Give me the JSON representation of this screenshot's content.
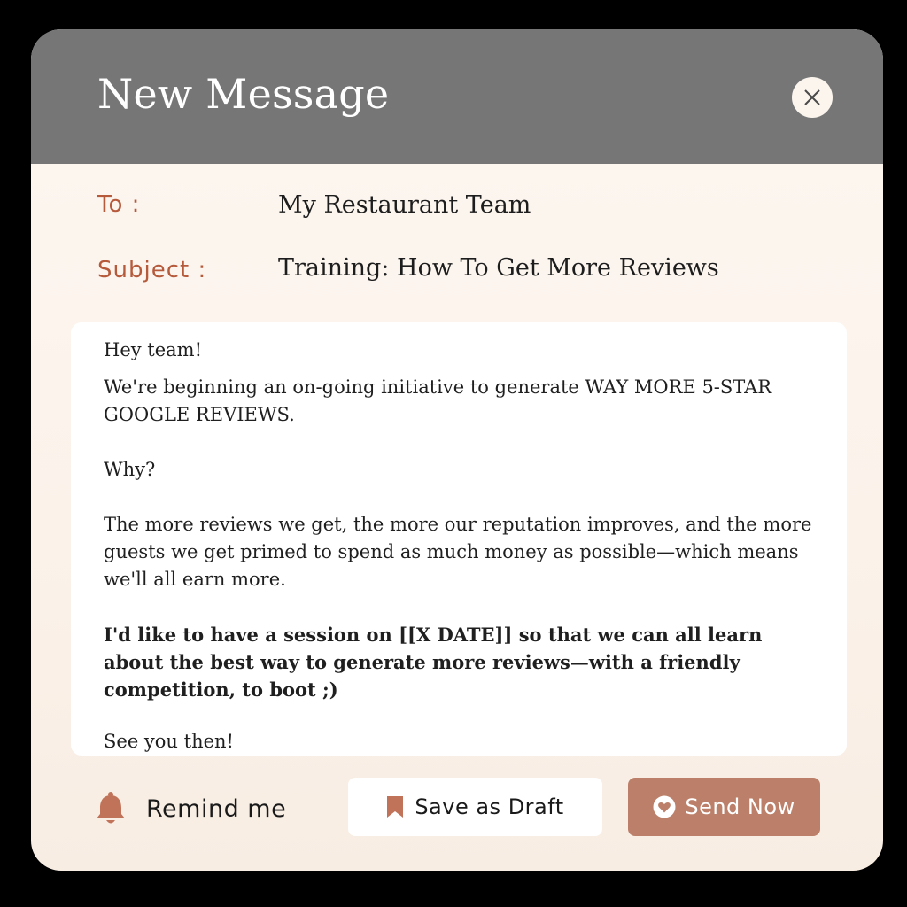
{
  "window": {
    "title": "New Message"
  },
  "colors": {
    "header": "#767676",
    "accent_label": "#b65a3c",
    "send_button": "#bc806a",
    "background": "#fdf7f1"
  },
  "icons": {
    "close": "close-icon",
    "reminder": "bell-icon",
    "draft": "bookmark-icon",
    "send": "heart-icon"
  },
  "fields": {
    "to_label": "To :",
    "to_value": "My Restaurant Team",
    "subject_label": "Subject :",
    "subject_value": "Training: How To Get More Reviews"
  },
  "message": {
    "greeting": "Hey team!",
    "line1": "We're beginning an on-going initiative to generate WAY MORE 5-STAR GOOGLE REVIEWS.",
    "line2": "Why?",
    "line3": "The more reviews we get, the more our reputation improves, and the more guests we get primed to spend as much money as possible—which means we'll all earn more.",
    "line4": "I'd like to have a session on [[X DATE]] so that we can all learn about the best way to generate more reviews—with a friendly competition, to boot ;)",
    "signoff": "See you then!"
  },
  "actions": {
    "remind_label": "Remind me",
    "draft_label": "Save as Draft",
    "send_label": "Send Now"
  }
}
